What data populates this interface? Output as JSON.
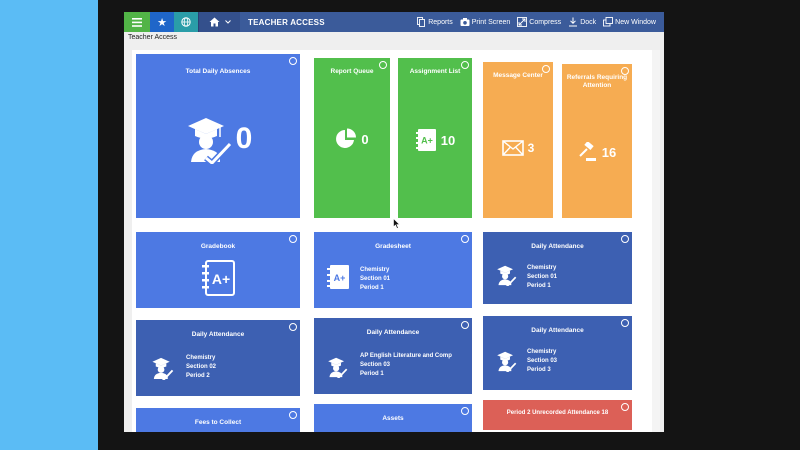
{
  "header": {
    "title": "TEACHER ACCESS",
    "actions": [
      {
        "label": "Reports",
        "icon": "reports-icon"
      },
      {
        "label": "Print Screen",
        "icon": "camera-icon"
      },
      {
        "label": "Compress",
        "icon": "compress-icon"
      },
      {
        "label": "Dock",
        "icon": "dock-icon"
      },
      {
        "label": "New Window",
        "icon": "new-window-icon"
      }
    ]
  },
  "breadcrumb": "Teacher Access",
  "tiles": {
    "absences": {
      "title": "Total Daily Absences",
      "count": "0"
    },
    "report_queue": {
      "title": "Report Queue",
      "count": "0"
    },
    "assignment_list": {
      "title": "Assignment List",
      "count": "10"
    },
    "message_center": {
      "title": "Message Center",
      "count": "3"
    },
    "referrals": {
      "title": "Referrals Requiring Attention",
      "count": "16"
    },
    "gradebook": {
      "title": "Gradebook"
    },
    "gradesheet": {
      "title": "Gradesheet",
      "lines": [
        "Chemistry",
        "Section 01",
        "Period 1"
      ]
    },
    "attendance1": {
      "title": "Daily Attendance",
      "lines": [
        "Chemistry",
        "Section 01",
        "Period 1"
      ]
    },
    "attendance2": {
      "title": "Daily Attendance",
      "lines": [
        "Chemistry",
        "Section 02",
        "Period 2"
      ]
    },
    "attendance3": {
      "title": "Daily Attendance",
      "lines": [
        "AP English Literature and Comp",
        "Section 03",
        "Period 1"
      ]
    },
    "attendance4": {
      "title": "Daily Attendance",
      "lines": [
        "Chemistry",
        "Section 03",
        "Period 3"
      ]
    },
    "fees": {
      "title": "Fees to Collect"
    },
    "assets": {
      "title": "Assets"
    },
    "unrecorded": {
      "title": "Period 2 Unrecorded Attendance 18"
    }
  },
  "colors": {
    "blue": "#4d79e3",
    "dark_blue": "#3d60b2",
    "green": "#52bf4c",
    "orange": "#f6ac52",
    "red": "#dc6057",
    "topbar": "#3b5b9a"
  }
}
